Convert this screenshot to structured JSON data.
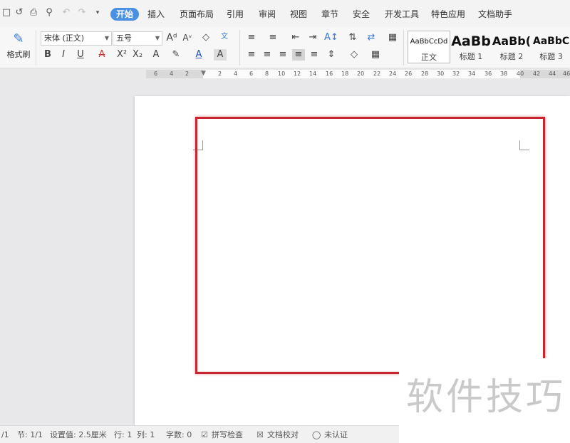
{
  "menubar": {
    "tabs": [
      "开始",
      "插入",
      "页面布局",
      "引用",
      "审阅",
      "视图",
      "章节",
      "安全",
      "开发工具",
      "特色应用",
      "文档助手"
    ],
    "active_tab": "开始"
  },
  "ribbon": {
    "format_painter_label": "格式刷",
    "font_name": "宋体 (正文)",
    "font_size": "五号",
    "styles": [
      {
        "sample": "AaBbCcDd",
        "name": "正文"
      },
      {
        "sample": "AaBb",
        "name": "标题 1"
      },
      {
        "sample": "AaBb(",
        "name": "标题 2"
      },
      {
        "sample": "AaBbC",
        "name": "标题 3"
      }
    ]
  },
  "ruler": {
    "ticks": [
      "6",
      "4",
      "2",
      "2",
      "4",
      "6",
      "8",
      "10",
      "12",
      "14",
      "16",
      "18",
      "20",
      "22",
      "24",
      "26",
      "28",
      "30",
      "32",
      "34",
      "36",
      "38",
      "40",
      "42",
      "44",
      "46"
    ]
  },
  "status": {
    "page": "/1",
    "section": "节: 1/1",
    "setting": "设置值: 2.5厘米",
    "row": "行: 1",
    "col": "列: 1",
    "word_count": "字数: 0",
    "spell_check": "拼写检查",
    "doc_proof": "文档校对",
    "auth": "未认证"
  },
  "watermark": "软件技巧",
  "colors": {
    "accent": "#4a90e2",
    "highlight_frame": "#c8262e"
  }
}
